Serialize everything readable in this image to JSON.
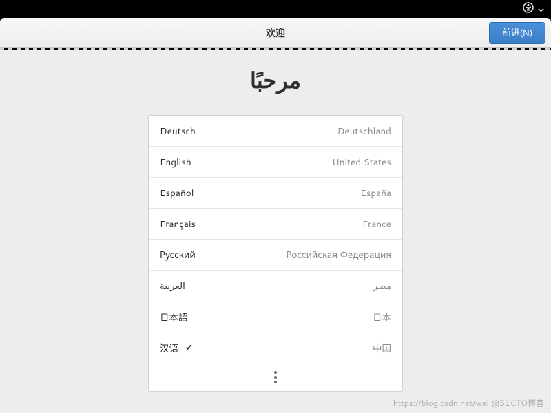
{
  "topbar": {
    "a11y_icon": "accessibility-icon",
    "dropdown_icon": "chevron-down-icon"
  },
  "headerbar": {
    "title": "欢迎",
    "next_label": "前进(N)"
  },
  "hero": {
    "text": "مرحبًا"
  },
  "languages": [
    {
      "name": "Deutsch",
      "region": "Deutschland",
      "selected": false
    },
    {
      "name": "English",
      "region": "United States",
      "selected": false
    },
    {
      "name": "Español",
      "region": "España",
      "selected": false
    },
    {
      "name": "Français",
      "region": "France",
      "selected": false
    },
    {
      "name": "Русский",
      "region": "Российская Федерация",
      "selected": false
    },
    {
      "name": "العربية",
      "region": "مصر",
      "selected": false
    },
    {
      "name": "日本語",
      "region": "日本",
      "selected": false
    },
    {
      "name": "汉语",
      "region": "中国",
      "selected": true
    }
  ],
  "check_glyph": "✔",
  "watermark": "https://blog.csdn.net/wei @51CTO博客"
}
